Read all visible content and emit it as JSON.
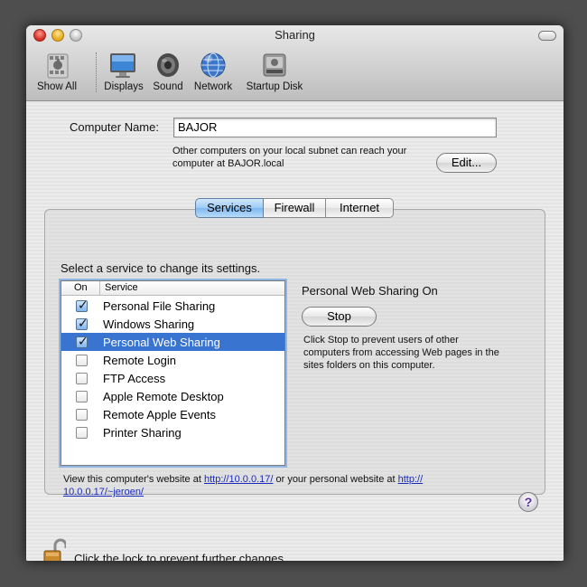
{
  "window": {
    "title": "Sharing"
  },
  "toolbar": {
    "items": [
      {
        "label": "Show All",
        "icon": "apple-grid-icon"
      },
      {
        "label": "Displays",
        "icon": "display-icon"
      },
      {
        "label": "Sound",
        "icon": "speaker-icon"
      },
      {
        "label": "Network",
        "icon": "globe-icon"
      },
      {
        "label": "Startup Disk",
        "icon": "hard-disk-icon"
      }
    ]
  },
  "computer": {
    "name_label": "Computer Name:",
    "name_value": "BAJOR",
    "subnet_note_line1": "Other computers on your local subnet can reach your",
    "subnet_note_line2": "computer at BAJOR.local",
    "edit_button": "Edit..."
  },
  "tabs": {
    "items": [
      "Services",
      "Firewall",
      "Internet"
    ],
    "selected": "Services"
  },
  "services": {
    "prompt": "Select a service to change its settings.",
    "columns": {
      "on": "On",
      "service": "Service"
    },
    "items": [
      {
        "name": "Personal File Sharing",
        "on": true
      },
      {
        "name": "Windows Sharing",
        "on": true
      },
      {
        "name": "Personal Web Sharing",
        "on": true,
        "selected": true
      },
      {
        "name": "Remote Login",
        "on": false
      },
      {
        "name": "FTP Access",
        "on": false
      },
      {
        "name": "Apple Remote Desktop",
        "on": false
      },
      {
        "name": "Remote Apple Events",
        "on": false
      },
      {
        "name": "Printer Sharing",
        "on": false
      }
    ]
  },
  "detail": {
    "status": "Personal Web Sharing On",
    "stop_button": "Stop",
    "description_line1": "Click Stop to prevent users of other",
    "description_line2": "computers from accessing Web pages in the",
    "description_line3": "sites folders on this computer."
  },
  "website": {
    "prefix": "View this computer's website at ",
    "link1": "http://10.0.0.17/",
    "middle": " or your personal website at ",
    "link2_part1": "http://",
    "link2_part2": "10.0.0.17/~jeroen/"
  },
  "help_button": "?",
  "lock": {
    "text": "Click the lock to prevent further changes."
  },
  "colors": {
    "selection": "#3874d0",
    "tab_selected": "#8fc3f2",
    "link": "#1a2bb8"
  }
}
